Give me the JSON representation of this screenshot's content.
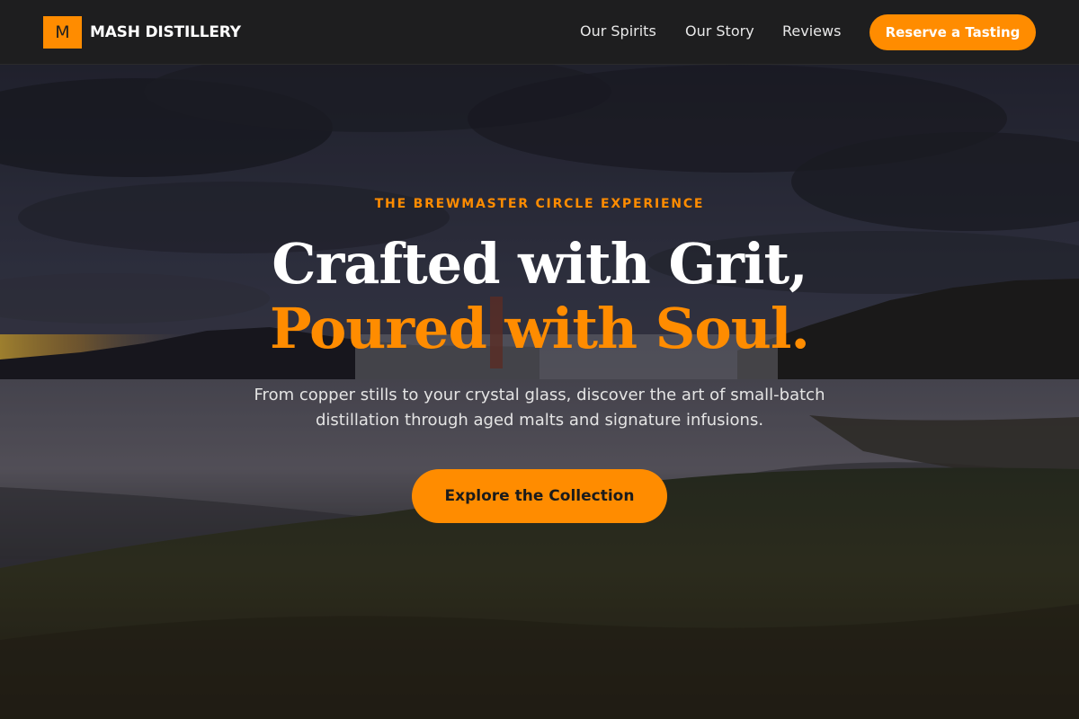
{
  "brand": {
    "logo_letter": "M",
    "name": "MASH DISTILLERY"
  },
  "nav": {
    "items": [
      {
        "label": "Our Spirits"
      },
      {
        "label": "Our Story"
      },
      {
        "label": "Reviews"
      }
    ],
    "cta_label": "Reserve a Tasting"
  },
  "hero": {
    "eyebrow": "THE BREWMASTER CIRCLE EXPERIENCE",
    "headline_line1": "Crafted with Grit,",
    "headline_line2": "Poured with Soul.",
    "subtext": "From copper stills to your crystal glass, discover the art of small-batch distillation through aged malts and signature infusions.",
    "cta_label": "Explore the Collection"
  },
  "colors": {
    "accent": "#ff8c00",
    "header_bg": "#1e1e1f",
    "text_light": "#ffffff"
  }
}
